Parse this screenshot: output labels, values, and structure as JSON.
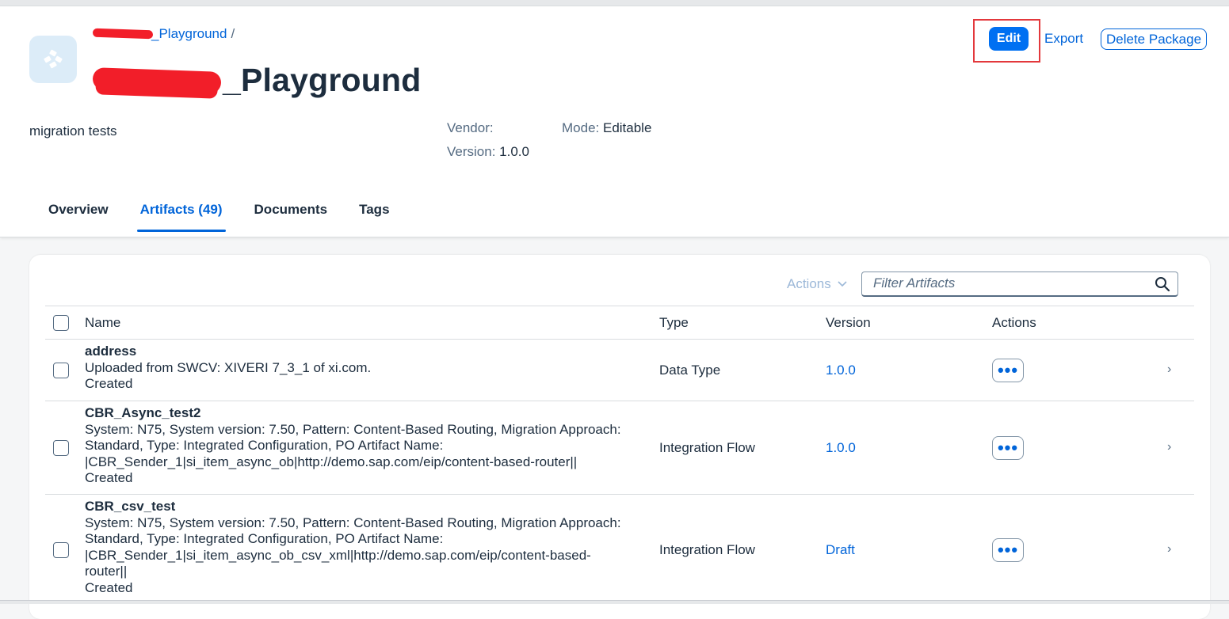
{
  "header": {
    "breadcrumb_suffix": "_Playground",
    "breadcrumb_sep": "/",
    "title_suffix": "_Playground",
    "buttons": {
      "edit": "Edit",
      "export": "Export",
      "delete": "Delete Package"
    },
    "description": "migration tests",
    "meta": {
      "vendor_label": "Vendor:",
      "vendor_value": "",
      "version_label": "Version:",
      "version_value": "1.0.0",
      "mode_label": "Mode:",
      "mode_value": "Editable"
    }
  },
  "tabs": [
    {
      "label": "Overview"
    },
    {
      "label": "Artifacts (49)",
      "active": true
    },
    {
      "label": "Documents"
    },
    {
      "label": "Tags"
    }
  ],
  "toolbar": {
    "actions_label": "Actions",
    "filter_placeholder": "Filter Artifacts"
  },
  "table": {
    "columns": [
      "Name",
      "Type",
      "Version",
      "Actions"
    ],
    "rows": [
      {
        "name": "address",
        "desc_lines": [
          "Uploaded from SWCV: XIVERI 7_3_1 of xi.com."
        ],
        "status": "Created",
        "type": "Data Type",
        "version": "1.0.0"
      },
      {
        "name": "CBR_Async_test2",
        "desc_lines": [
          "System: N75, System version: 7.50, Pattern: Content-Based Routing, Migration Approach:",
          "Standard, Type: Integrated Configuration, PO Artifact Name:",
          "|CBR_Sender_1|si_item_async_ob|http://demo.sap.com/eip/content-based-router||"
        ],
        "status": "Created",
        "type": "Integration Flow",
        "version": "1.0.0"
      },
      {
        "name": "CBR_csv_test",
        "desc_lines": [
          "System: N75, System version: 7.50, Pattern: Content-Based Routing, Migration Approach:",
          "Standard, Type: Integrated Configuration, PO Artifact Name:",
          "|CBR_Sender_1|si_item_async_ob_csv_xml|http://demo.sap.com/eip/content-based-",
          "router||"
        ],
        "status": "Created",
        "type": "Integration Flow",
        "version": "Draft"
      }
    ]
  },
  "colors": {
    "accent": "#0064d9",
    "edit_button": "#0070f2",
    "highlight": "#e3383c",
    "redaction": "#f21e29"
  },
  "icons": [
    "package-icon",
    "search-icon",
    "chevron-down-icon",
    "more-icon",
    "chevron-right-icon"
  ]
}
